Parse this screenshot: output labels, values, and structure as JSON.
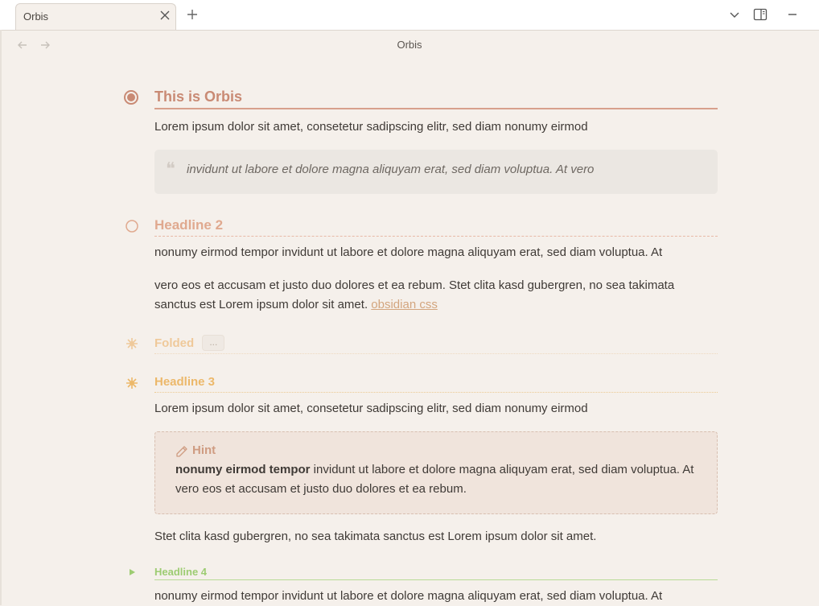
{
  "tabbar": {
    "tab_title": "Orbis",
    "close_icon": "close-icon",
    "new_tab_icon": "plus-icon",
    "dropdown_icon": "chevron-down-icon",
    "sidebar_icon": "sidebar-toggle-icon",
    "minimize_icon": "minimize-icon"
  },
  "nav": {
    "view_title": "Orbis",
    "back_icon": "arrow-left-icon",
    "forward_icon": "arrow-right-icon"
  },
  "doc": {
    "h1": "This is Orbis",
    "p1": "Lorem ipsum dolor sit amet, consetetur sadipscing elitr, sed diam nonumy eirmod",
    "quote": "invidunt ut labore et dolore magna aliquyam erat, sed diam voluptua. At vero",
    "h2": "Headline 2",
    "p2": "nonumy eirmod tempor invidunt ut labore et dolore magna aliquyam erat, sed diam voluptua. At",
    "p3_line1": "vero eos et accusam et justo duo dolores et ea rebum. Stet clita kasd gubergren, no sea takimata",
    "p3_line2": "sanctus est Lorem ipsum dolor sit amet.",
    "p3_link": "obsidian css",
    "folded": "Folded",
    "folded_pill": "...",
    "h3": "Headline 3",
    "p4": "Lorem ipsum dolor sit amet, consetetur sadipscing elitr, sed diam nonumy eirmod",
    "hint_title": "Hint",
    "hint_bold": "nonumy eirmod tempor",
    "hint_rest": " invidunt ut labore et dolore magna aliquyam erat, sed diam voluptua. At vero eos et accusam et justo duo dolores et ea rebum.",
    "p5": "Stet clita kasd gubergren, no sea takimata sanctus est Lorem ipsum dolor sit amet.",
    "h4": "Headline 4",
    "p6": "nonumy eirmod tempor invidunt ut labore et dolore magna aliquyam erat, sed diam voluptua. At"
  },
  "colors": {
    "background": "#f5f0eb",
    "h1": "#c98a74",
    "h2": "#e0a98f",
    "h3": "#ecb86a",
    "h4": "#9dcc72",
    "link": "#d3a57e"
  }
}
